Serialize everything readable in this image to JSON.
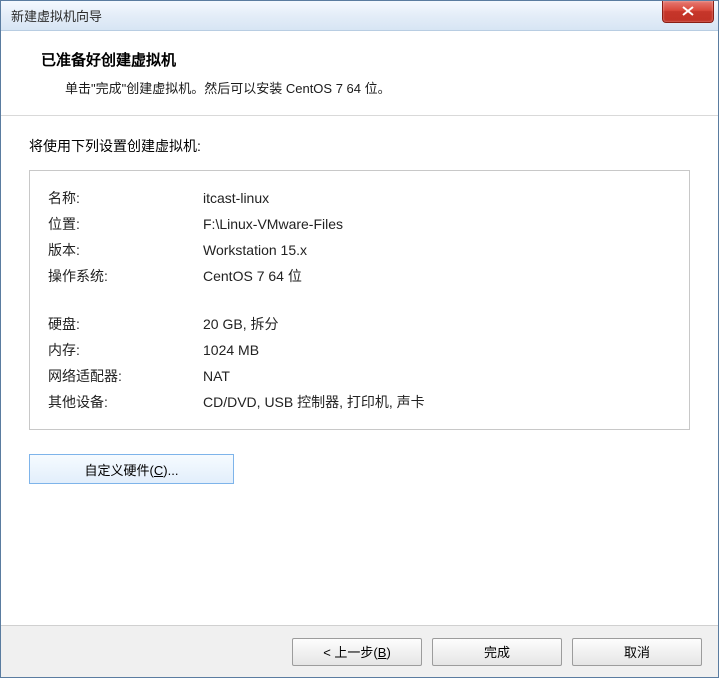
{
  "window": {
    "title": "新建虚拟机向导"
  },
  "header": {
    "title": "已准备好创建虚拟机",
    "subtitle": "单击\"完成\"创建虚拟机。然后可以安装 CentOS 7 64 位。"
  },
  "settings_intro": "将使用下列设置创建虚拟机:",
  "summary": {
    "name_label": "名称:",
    "name_value": "itcast-linux",
    "location_label": "位置:",
    "location_value": "F:\\Linux-VMware-Files",
    "version_label": "版本:",
    "version_value": "Workstation 15.x",
    "os_label": "操作系统:",
    "os_value": "CentOS 7 64 位",
    "disk_label": "硬盘:",
    "disk_value": "20 GB, 拆分",
    "memory_label": "内存:",
    "memory_value": "1024 MB",
    "network_label": "网络适配器:",
    "network_value": "NAT",
    "other_label": "其他设备:",
    "other_value": "CD/DVD, USB 控制器, 打印机, 声卡"
  },
  "buttons": {
    "customize_prefix": "自定义硬件(",
    "customize_key": "C",
    "customize_suffix": ")...",
    "back_prefix": "< 上一步(",
    "back_key": "B",
    "back_suffix": ")",
    "finish": "完成",
    "cancel": "取消"
  }
}
